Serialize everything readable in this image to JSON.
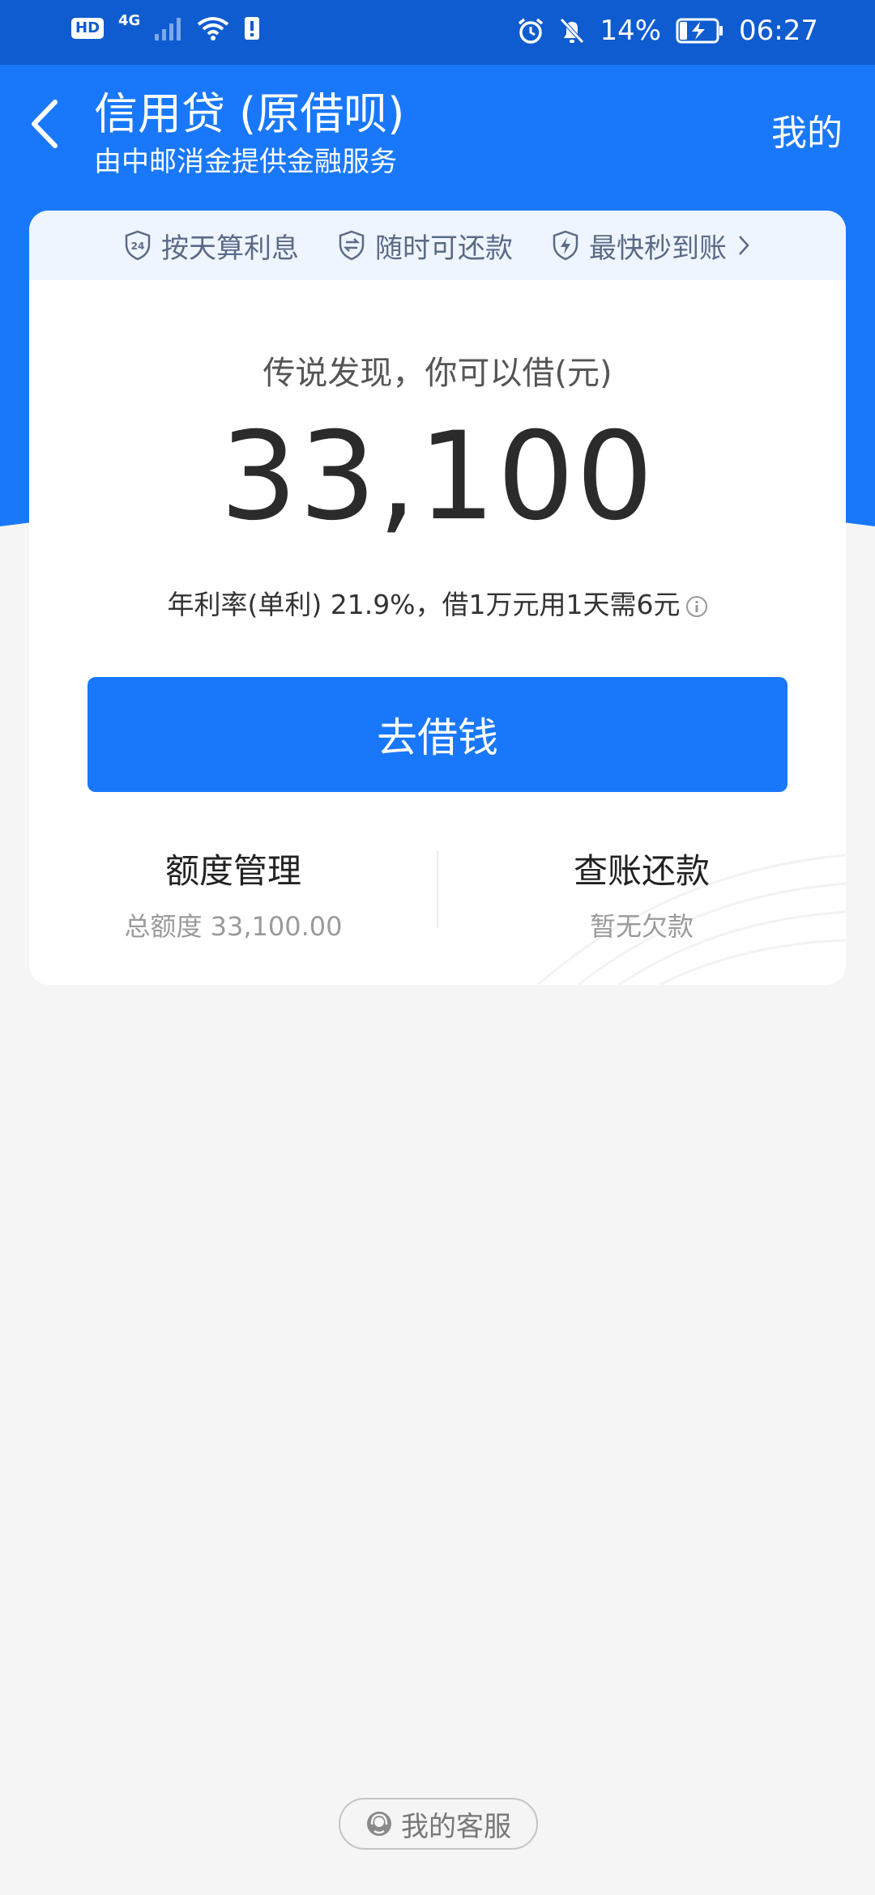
{
  "status_bar": {
    "hd": "HD",
    "network": "4G",
    "battery": "14%",
    "time": "06:27"
  },
  "header": {
    "title": "信用贷 (原借呗)",
    "subtitle": "由中邮消金提供金融服务",
    "mine_label": "我的"
  },
  "features": [
    {
      "label": "按天算利息",
      "icon": "calendar-24-shield-icon"
    },
    {
      "label": "随时可还款",
      "icon": "exchange-shield-icon"
    },
    {
      "label": "最快秒到账",
      "icon": "lightning-shield-icon"
    }
  ],
  "loan": {
    "borrow_label": "传说发现，你可以借(元)",
    "amount": "33,100",
    "rate_text": "年利率(单利) 21.9%，借1万元用1天需6元",
    "borrow_button": "去借钱"
  },
  "bottom": {
    "limit_title": "额度管理",
    "limit_sub": "总额度 33,100.00",
    "repay_title": "查账还款",
    "repay_sub": "暂无欠款"
  },
  "service": {
    "label": "我的客服"
  },
  "colors": {
    "status_bar": "#0e5cd0",
    "primary": "#1978fa",
    "background": "#f5f5f5",
    "feature_bar": "#eef5ff"
  }
}
